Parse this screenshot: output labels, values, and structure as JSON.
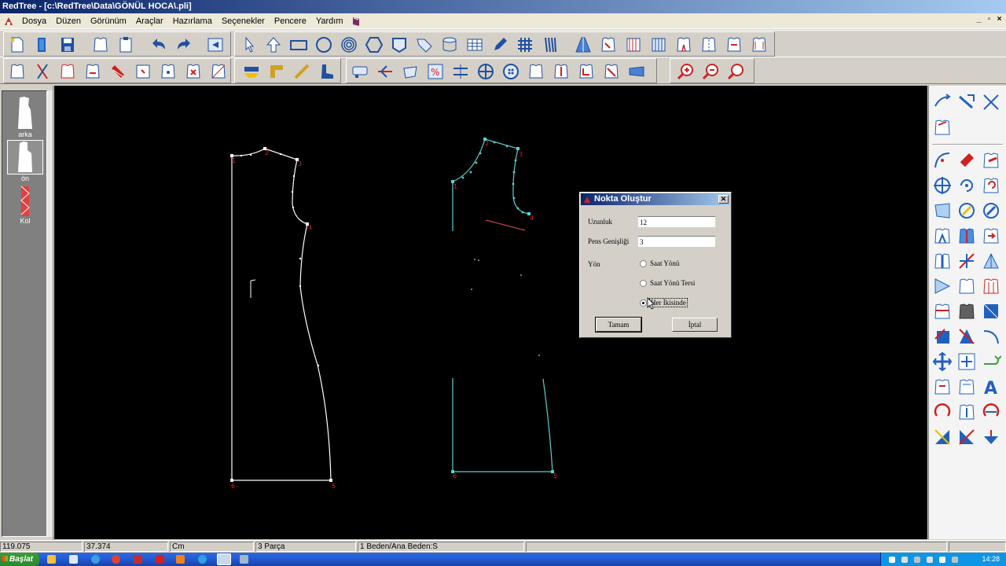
{
  "window": {
    "title": "RedTree - [c:\\RedTree\\Data\\GÖNÜL HOCA\\.pli]"
  },
  "menu": {
    "items": [
      "Dosya",
      "Düzen",
      "Görünüm",
      "Araçlar",
      "Hazırlama",
      "Seçenekler",
      "Pencere",
      "Yardım"
    ]
  },
  "parts": [
    {
      "label": "arka"
    },
    {
      "label": "ön"
    },
    {
      "label": "Kol"
    }
  ],
  "dialog": {
    "title": "Nokta Oluştur",
    "uzunluk_label": "Uzunluk",
    "uzunluk_value": "12",
    "pervaz_label": "Pens Genişliği",
    "pervaz_value": "3",
    "yon_label": "Yön",
    "radio_cw": "Saat Yönü",
    "radio_ccw": "Saat Yönü Tersi",
    "radio_both": "Her İkisinde",
    "ok_label": "Tamam",
    "cancel_label": "İptal"
  },
  "canvas": {
    "back_piece_numbers": [
      "1",
      "2",
      "3",
      "4",
      "5",
      "6"
    ],
    "front_piece_numbers": [
      "1",
      "2",
      "3",
      "4",
      "5",
      "6"
    ]
  },
  "status": {
    "x": "119.075",
    "y": "37.374",
    "unit": "Cm",
    "parts": "3 Parça",
    "size": "1 Beden/Ana Beden:S"
  },
  "taskbar": {
    "start_label": "Başlat",
    "clock": "14:28"
  },
  "colors": {
    "canvas_bg": "#000000",
    "back_piece": "#ffffff",
    "front_piece": "#5ad0d0",
    "point_number": "#e02020",
    "dart_line": "#c04040"
  }
}
